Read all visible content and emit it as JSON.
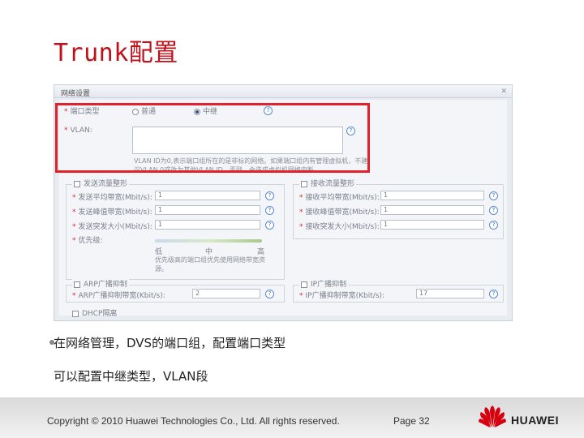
{
  "slide": {
    "title": "Trunk配置",
    "bullet": "在网络管理，DVS的端口组，配置端口类型",
    "line2": "可以配置中继类型，VLAN段"
  },
  "dialog": {
    "title": "网络设置",
    "close": "✕",
    "port_type_label": "端口类型",
    "option_normal": "普通",
    "option_trunk": "中继",
    "vlan_label": "VLAN:",
    "vlan_value": "",
    "vlan_note": "VLAN ID为0,表示端口组所在的是非标的网络。如果端口组内有管理虚拟机，不建议VLAN 0或改为其他VLAN ID，否则，会造成虚拟机网络中断。",
    "left_section": {
      "title": "发送流量整形",
      "rows": [
        {
          "label": "发送平均带宽(Mbit/s):",
          "value": "1"
        },
        {
          "label": "发送峰值带宽(Mbit/s):",
          "value": "1"
        },
        {
          "label": "发送突发大小(Mbit/s):",
          "value": "1"
        }
      ],
      "priority_label": "优先级:",
      "slider_low": "低",
      "slider_mid": "中",
      "slider_high": "高",
      "slider_note": "优先级高的端口组优先使用网络带宽资源。"
    },
    "right_section": {
      "title": "接收流量整形",
      "rows": [
        {
          "label": "接收平均带宽(Mbit/s):",
          "value": "1"
        },
        {
          "label": "接收峰值带宽(Mbit/s):",
          "value": "1"
        },
        {
          "label": "接收突发大小(Mbit/s):",
          "value": "1"
        }
      ]
    },
    "arp": {
      "title": "ARP广播抑制",
      "label": "ARP广播抑制带宽(Kbit/s):",
      "value": "2"
    },
    "ip": {
      "title": "IP广播抑制",
      "label": "IP广播抑制带宽(Kbit/s):",
      "value": "17"
    },
    "dhcp": {
      "title": "DHCP隔离"
    }
  },
  "footer": {
    "copyright": "Copyright © 2010 Huawei Technologies Co., Ltd. All rights reserved.",
    "page": "Page 32",
    "brand": "HUAWEI"
  },
  "colors": {
    "title_red": "#c0101a",
    "highlight_red": "#e2222a"
  }
}
